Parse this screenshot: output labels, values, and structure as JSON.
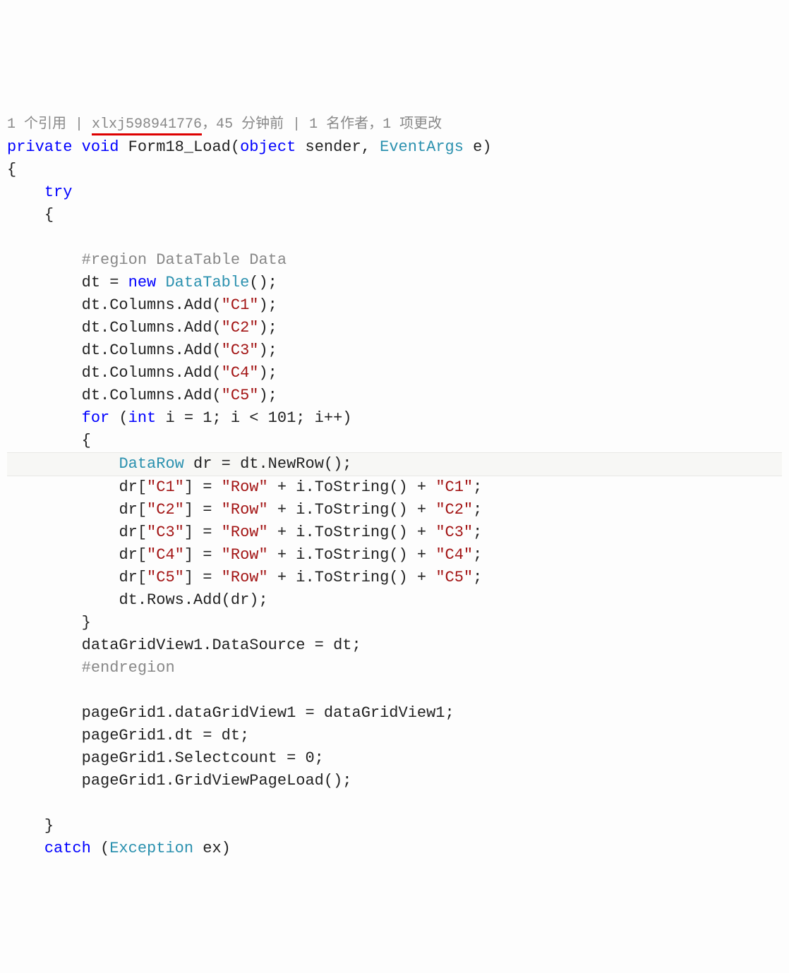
{
  "codelens": {
    "references": "1 个引用",
    "sep1": " | ",
    "author": "xlxj598941776",
    "when": "，45 分钟前",
    "sep2": " | ",
    "authors": "1 名作者，1 项更改"
  },
  "code": {
    "kw_private": "private",
    "kw_void": "void",
    "method_name": "Form18_Load",
    "kw_object": "object",
    "param_sender": "sender",
    "type_eventargs": "EventArgs",
    "param_e": "e",
    "brace_open": "{",
    "kw_try": "try",
    "brace_open2": "{",
    "region": "#region DataTable Data",
    "dt_eq": "dt = ",
    "kw_new": "new",
    "type_datatable": "DataTable",
    "col_prefix": "dt.Columns.Add(",
    "c1": "\"C1\"",
    "c2": "\"C2\"",
    "c3": "\"C3\"",
    "c4": "\"C4\"",
    "c5": "\"C5\"",
    "col_suffix": ");",
    "kw_for": "for",
    "for_open": " (",
    "kw_int": "int",
    "for_body": " i = 1; i < 101; i++)",
    "brace_open3": "{",
    "type_datarow": "DataRow",
    "dr_assign": " dr = dt.NewRow();",
    "dr_prefix": "dr[",
    "dr_mid": "] = ",
    "str_row": "\"Row\"",
    "dr_plus": " + i.ToString() + ",
    "semi": ";",
    "rows_add": "dt.Rows.Add(dr);",
    "brace_close3": "}",
    "ds_line": "dataGridView1.DataSource = dt;",
    "endregion": "#endregion",
    "pg1": "pageGrid1.dataGridView1 = dataGridView1;",
    "pg2": "pageGrid1.dt = dt;",
    "pg3": "pageGrid1.Selectcount = 0;",
    "pg4": "pageGrid1.GridViewPageLoad();",
    "brace_close2": "}",
    "kw_catch": "catch",
    "catch_open": " (",
    "type_exception": "Exception",
    "catch_ex": " ex)"
  }
}
